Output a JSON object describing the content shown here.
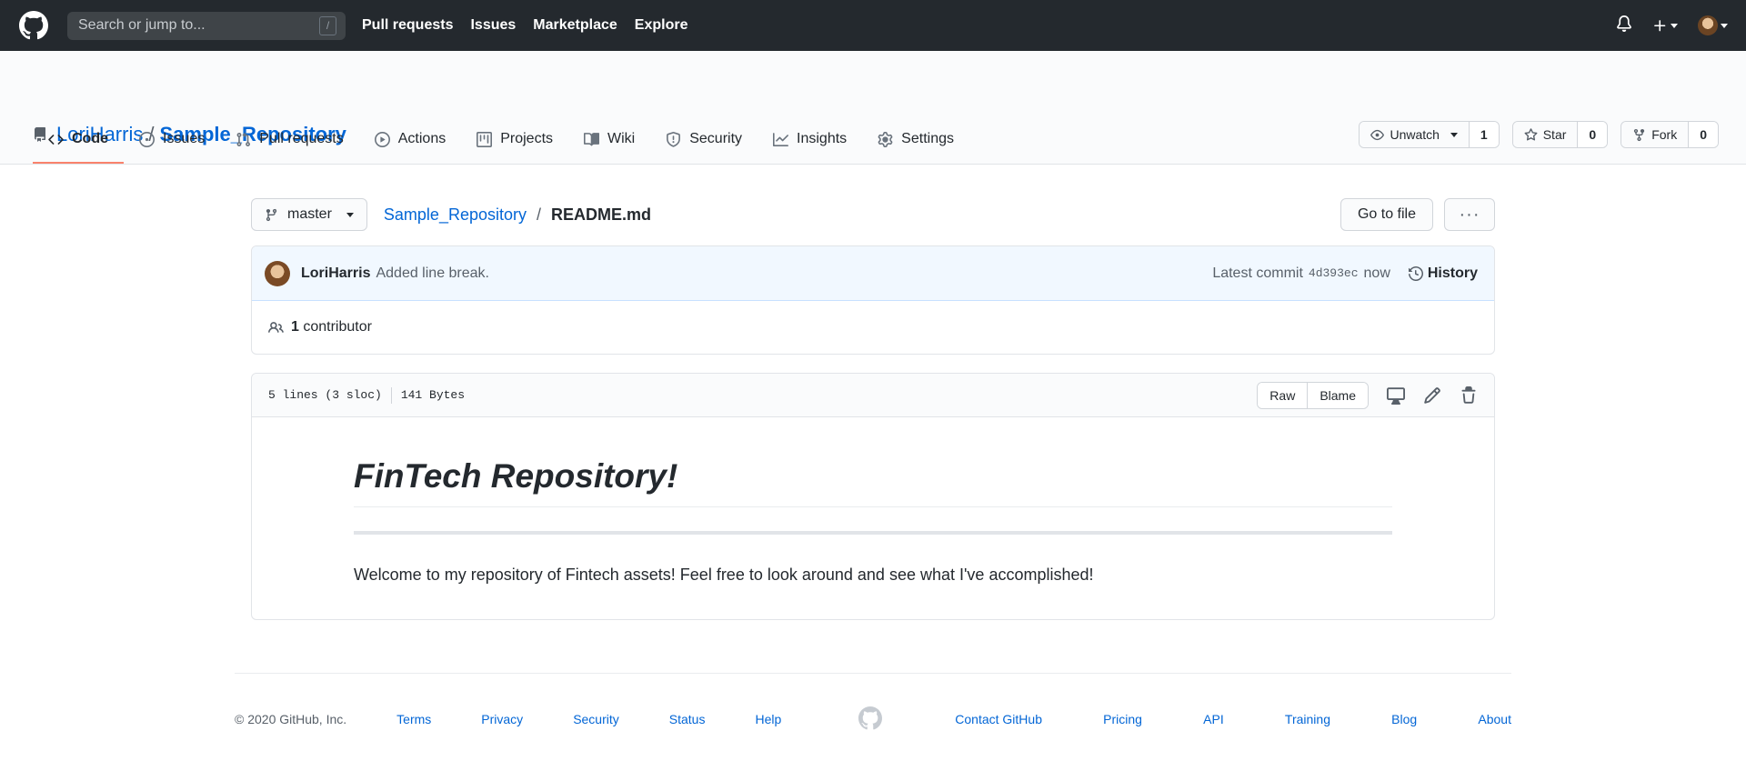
{
  "header": {
    "search_placeholder": "Search or jump to...",
    "search_key": "/",
    "nav": [
      "Pull requests",
      "Issues",
      "Marketplace",
      "Explore"
    ]
  },
  "repo": {
    "owner": "LoriHarris",
    "separator": "/",
    "name": "Sample_Repository",
    "watch_label": "Unwatch",
    "watch_count": "1",
    "star_label": "Star",
    "star_count": "0",
    "fork_label": "Fork",
    "fork_count": "0"
  },
  "tabs": [
    {
      "label": "Code",
      "icon": "code-icon",
      "active": true
    },
    {
      "label": "Issues",
      "icon": "issue-icon"
    },
    {
      "label": "Pull requests",
      "icon": "pull-request-icon"
    },
    {
      "label": "Actions",
      "icon": "play-icon"
    },
    {
      "label": "Projects",
      "icon": "project-icon"
    },
    {
      "label": "Wiki",
      "icon": "book-icon"
    },
    {
      "label": "Security",
      "icon": "shield-icon"
    },
    {
      "label": "Insights",
      "icon": "graph-icon"
    },
    {
      "label": "Settings",
      "icon": "gear-icon"
    }
  ],
  "file": {
    "branch": "master",
    "breadcrumb_repo": "Sample_Repository",
    "breadcrumb_sep": "/",
    "filename": "README.md",
    "go_to_file": "Go to file",
    "more": "···"
  },
  "commit": {
    "author": "LoriHarris",
    "message": "Added line break.",
    "latest_label": "Latest commit",
    "sha": "4d393ec",
    "time": "now",
    "history_label": "History",
    "contributors_count": "1",
    "contributors_label": "contributor"
  },
  "file_header": {
    "lines": "5 lines (3 sloc)",
    "size": "141 Bytes",
    "raw": "Raw",
    "blame": "Blame"
  },
  "readme": {
    "heading": "FinTech Repository!",
    "paragraph": "Welcome to my repository of Fintech assets! Feel free to look around and see what I've accomplished!"
  },
  "footer": {
    "copyright": "© 2020 GitHub, Inc.",
    "left_links": [
      "Terms",
      "Privacy",
      "Security",
      "Status",
      "Help"
    ],
    "right_links": [
      "Contact GitHub",
      "Pricing",
      "API",
      "Training",
      "Blog",
      "About"
    ]
  },
  "colors": {
    "header_bg": "#24292e",
    "link": "#0366d6",
    "tab_underline": "#f9826c",
    "commit_bg": "#f1f8ff"
  }
}
